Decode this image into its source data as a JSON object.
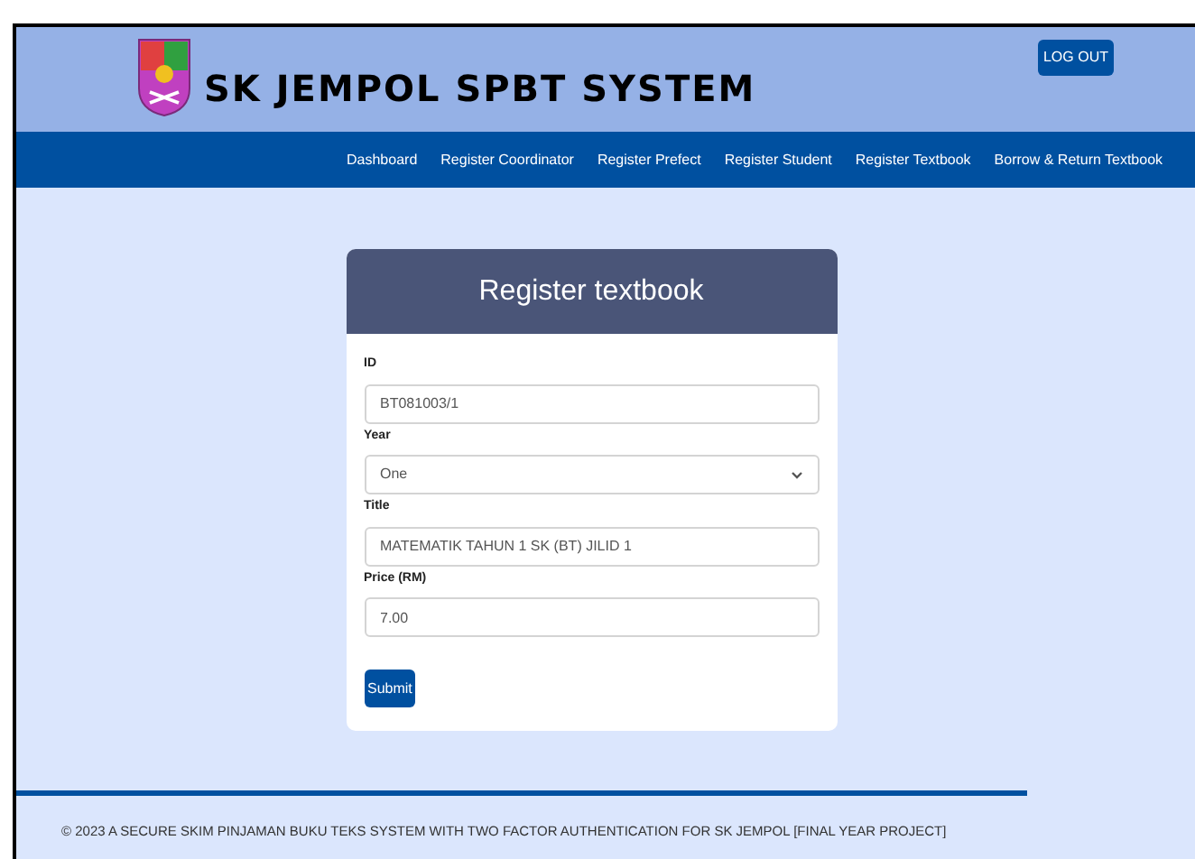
{
  "header": {
    "title": "SK JEMPOL SPBT SYSTEM",
    "logout": "LOG OUT"
  },
  "nav": [
    "Dashboard",
    "Register Coordinator",
    "Register Prefect",
    "Register Student",
    "Register Textbook",
    "Borrow & Return Textbook"
  ],
  "form": {
    "title": "Register textbook",
    "fields": [
      {
        "kind": "input",
        "label": "ID",
        "value": "BT081003/1"
      },
      {
        "kind": "select",
        "label": "Year",
        "value": "One"
      },
      {
        "kind": "input",
        "label": "Title",
        "value": "MATEMATIK TAHUN 1 SK (BT) JILID 1"
      },
      {
        "kind": "input",
        "label": "Price (RM)",
        "value": "7.00"
      }
    ],
    "submit": "Submit"
  },
  "footer": "© 2023 A SECURE SKIM PINJAMAN BUKU TEKS SYSTEM WITH TWO FACTOR AUTHENTICATION FOR SK JEMPOL [FINAL YEAR PROJECT]"
}
